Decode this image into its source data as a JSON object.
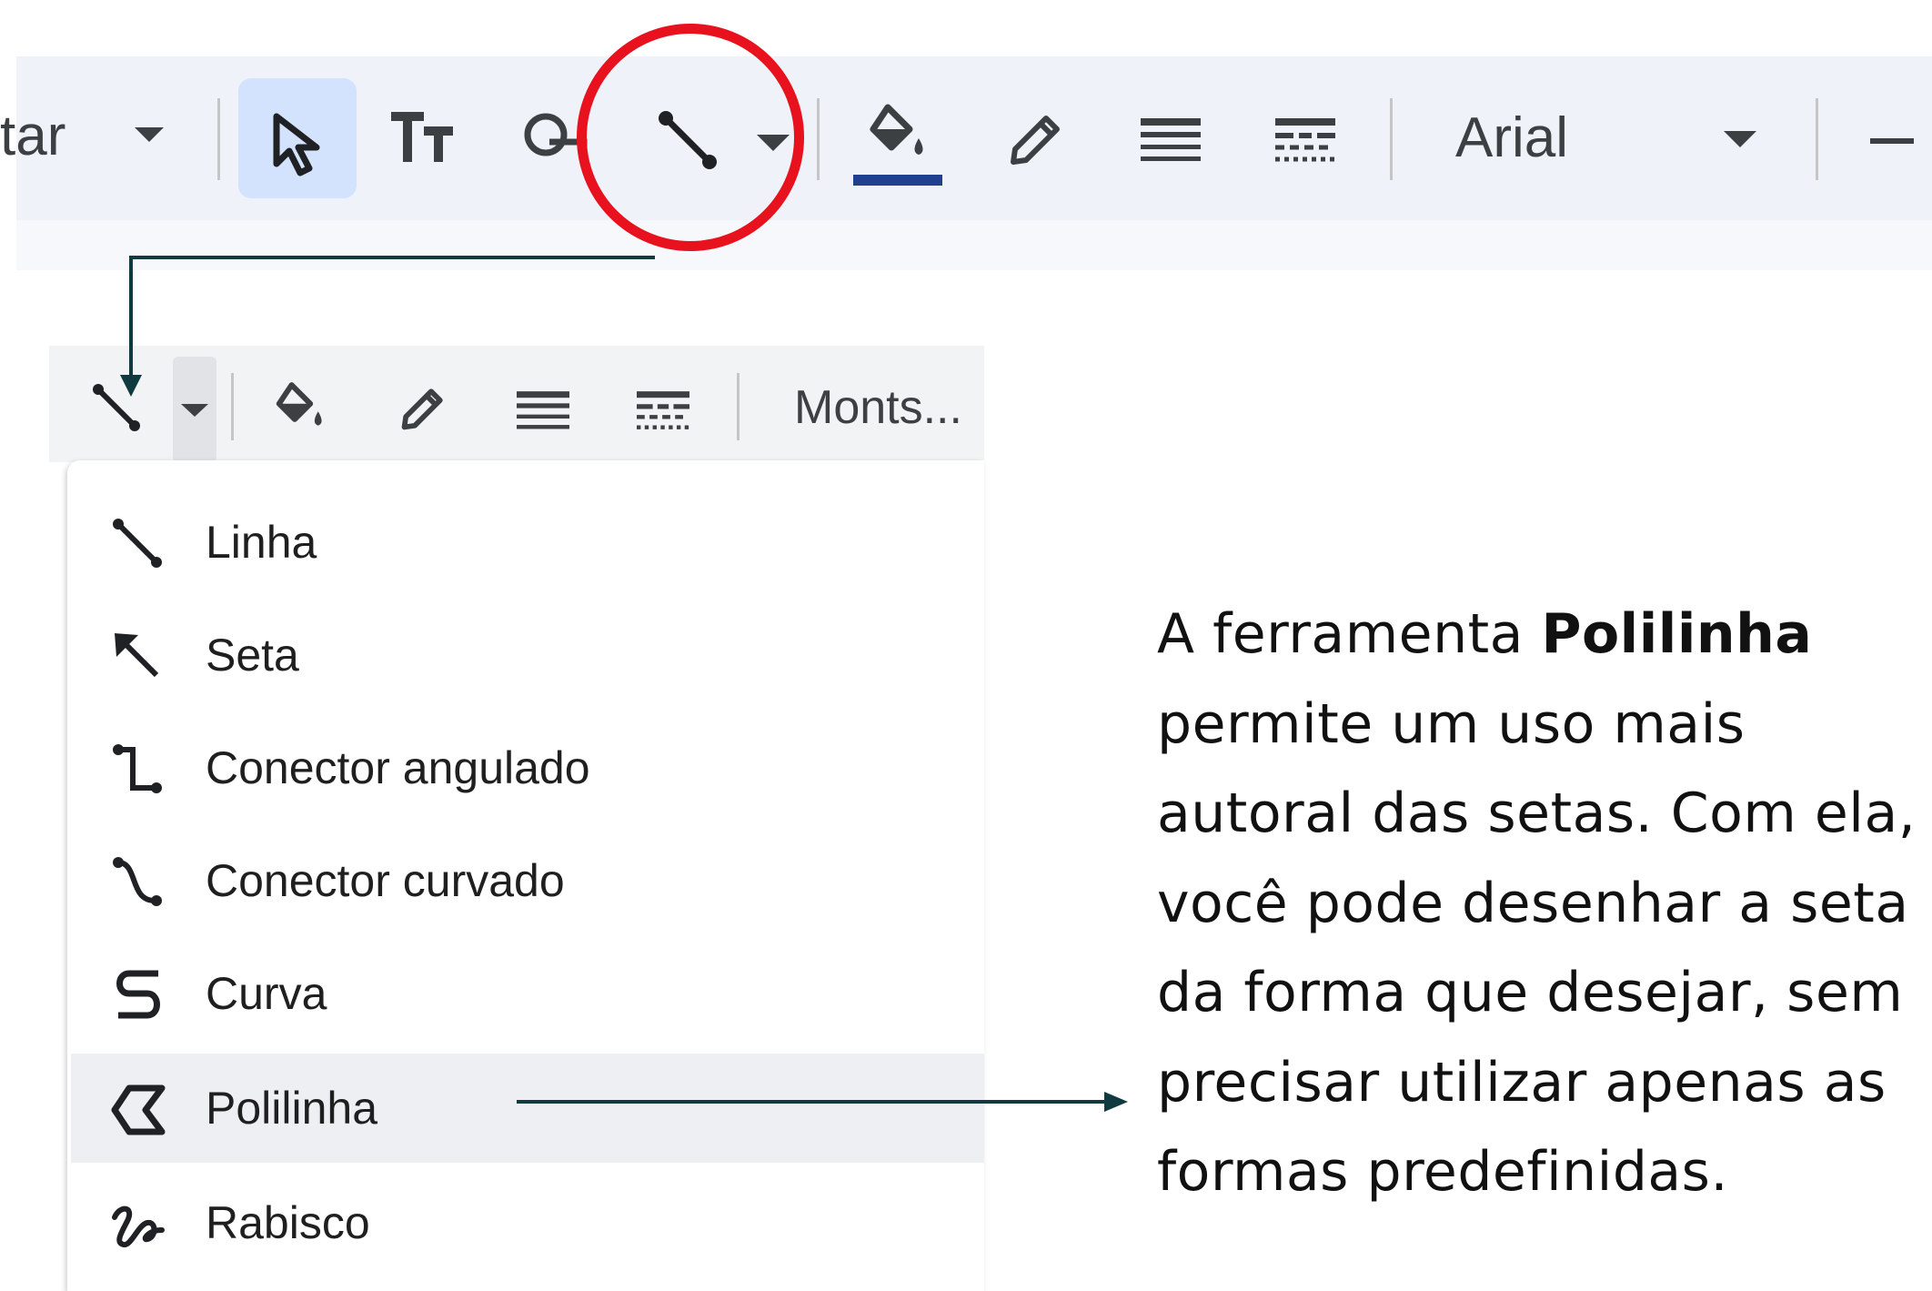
{
  "top_toolbar": {
    "partial_label": "tar",
    "font_name": "Arial",
    "icons": [
      "dropdown-caret-icon",
      "select-arrow-icon",
      "text-box-icon",
      "shape-icon",
      "line-tool-icon",
      "line-dropdown-icon",
      "fill-color-icon",
      "border-color-icon",
      "border-weight-icon",
      "border-dash-icon",
      "font-dropdown-icon",
      "minus-icon"
    ],
    "fill_color_bar": "#1f3f8f"
  },
  "highlight_color": "#e8121f",
  "arrow_color": "#0f3a3f",
  "sub_toolbar": {
    "font_name": "Monts..."
  },
  "menu": {
    "items": [
      {
        "label": "Linha",
        "icon": "line-icon"
      },
      {
        "label": "Seta",
        "icon": "arrow-icon"
      },
      {
        "label": "Conector angulado",
        "icon": "elbow-connector-icon"
      },
      {
        "label": "Conector curvado",
        "icon": "curved-connector-icon"
      },
      {
        "label": "Curva",
        "icon": "curve-icon"
      },
      {
        "label": "Polilinha",
        "icon": "polyline-icon",
        "selected": true
      },
      {
        "label": "Rabisco",
        "icon": "scribble-icon"
      }
    ]
  },
  "note": {
    "prefix": "A ferramenta ",
    "bold": "Polilinha",
    "rest": " permite um uso mais autoral das setas. Com ela, você pode desenhar a seta da forma que desejar, sem precisar utilizar apenas as formas predefinidas."
  }
}
